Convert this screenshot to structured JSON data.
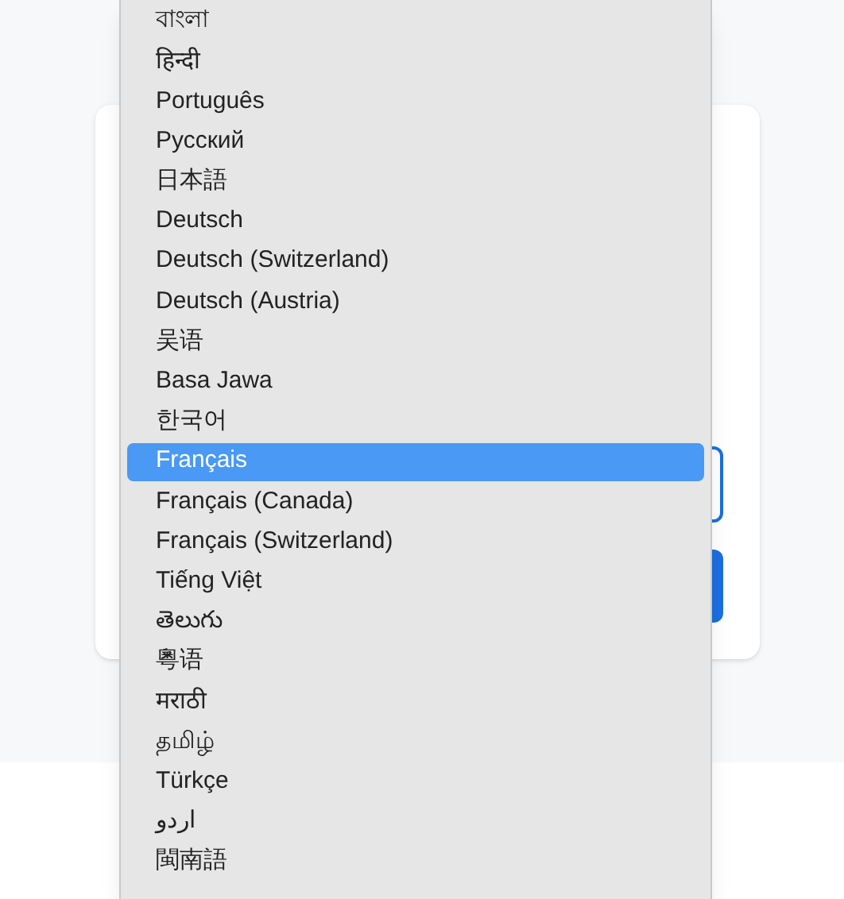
{
  "language_menu": {
    "items": [
      {
        "label": "বাংলা",
        "selected": false
      },
      {
        "label": "हिन्दी",
        "selected": false
      },
      {
        "label": "Português",
        "selected": false
      },
      {
        "label": "Русский",
        "selected": false
      },
      {
        "label": "日本語",
        "selected": false
      },
      {
        "label": "Deutsch",
        "selected": false
      },
      {
        "label": "Deutsch (Switzerland)",
        "selected": false
      },
      {
        "label": "Deutsch (Austria)",
        "selected": false
      },
      {
        "label": "吴语",
        "selected": false
      },
      {
        "label": "Basa Jawa",
        "selected": false
      },
      {
        "label": "한국어",
        "selected": false
      },
      {
        "label": "Français",
        "selected": true
      },
      {
        "label": "Français (Canada)",
        "selected": false
      },
      {
        "label": "Français (Switzerland)",
        "selected": false
      },
      {
        "label": "Tiếng Việt",
        "selected": false
      },
      {
        "label": "తెలుగు",
        "selected": false
      },
      {
        "label": "粵语",
        "selected": false
      },
      {
        "label": "मराठी",
        "selected": false
      },
      {
        "label": "தமிழ்",
        "selected": false
      },
      {
        "label": "Türkçe",
        "selected": false
      },
      {
        "label": "اردو",
        "selected": false
      },
      {
        "label": "閩南語",
        "selected": false
      }
    ]
  }
}
